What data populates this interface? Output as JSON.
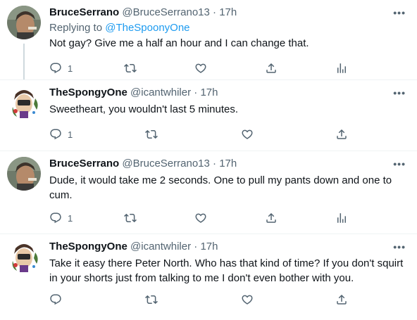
{
  "tweets": [
    {
      "name": "BruceSerrano",
      "handle": "@BruceSerrano13",
      "dot": "·",
      "time": "17h",
      "replying_prefix": "Replying to ",
      "replying_to": "@TheSpoonyOne",
      "text": "Not gay? Give me a half an hour and I can change that.",
      "reply_count": "1",
      "more": "•••"
    },
    {
      "name": "TheSpongyOne",
      "handle": "@icantwhiler",
      "dot": "·",
      "time": "17h",
      "text": "Sweetheart, you wouldn't last 5 minutes.",
      "reply_count": "1",
      "more": "•••"
    },
    {
      "name": "BruceSerrano",
      "handle": "@BruceSerrano13",
      "dot": "·",
      "time": "17h",
      "text": "Dude, it would take me 2 seconds. One to pull my pants down and one to cum.",
      "reply_count": "1",
      "more": "•••"
    },
    {
      "name": "TheSpongyOne",
      "handle": "@icantwhiler",
      "dot": "·",
      "time": "17h",
      "text": "Take it easy there Peter North. Who has that kind of time? If you don't squirt in your shorts just from talking to me I don't even bother with you.",
      "reply_count": "",
      "more": "•••"
    }
  ],
  "icons": {
    "reply": "reply-icon",
    "retweet": "retweet-icon",
    "like": "heart-icon",
    "share": "share-icon",
    "analytics": "analytics-icon",
    "more": "more-icon"
  },
  "colors": {
    "link": "#1d9bf0",
    "secondary": "#536471",
    "thread_line": "#cfd9de"
  }
}
